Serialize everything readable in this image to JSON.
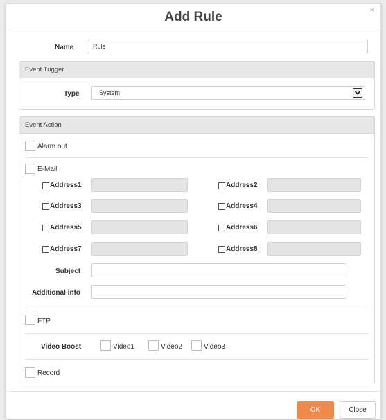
{
  "dialog": {
    "title": "Add Rule",
    "close_glyph": "×"
  },
  "name": {
    "label": "Name",
    "value": "Rule"
  },
  "event_trigger": {
    "header": "Event Trigger",
    "type_label": "Type",
    "type_value": "System"
  },
  "event_action": {
    "header": "Event Action",
    "alarm_out": "Alarm out",
    "email": {
      "label": "E-Mail",
      "addresses": [
        "Address1",
        "Address2",
        "Address3",
        "Address4",
        "Address5",
        "Address6",
        "Address7",
        "Address8"
      ],
      "subject_label": "Subject",
      "additional_label": "Additional info"
    },
    "ftp": "FTP",
    "video_boost": {
      "label": "Video Boost",
      "options": [
        "Video1",
        "Video2",
        "Video3"
      ]
    },
    "record": "Record"
  },
  "footer": {
    "ok_label": "OK",
    "close_label": "Close",
    "ok_color": "#f08a4b"
  }
}
